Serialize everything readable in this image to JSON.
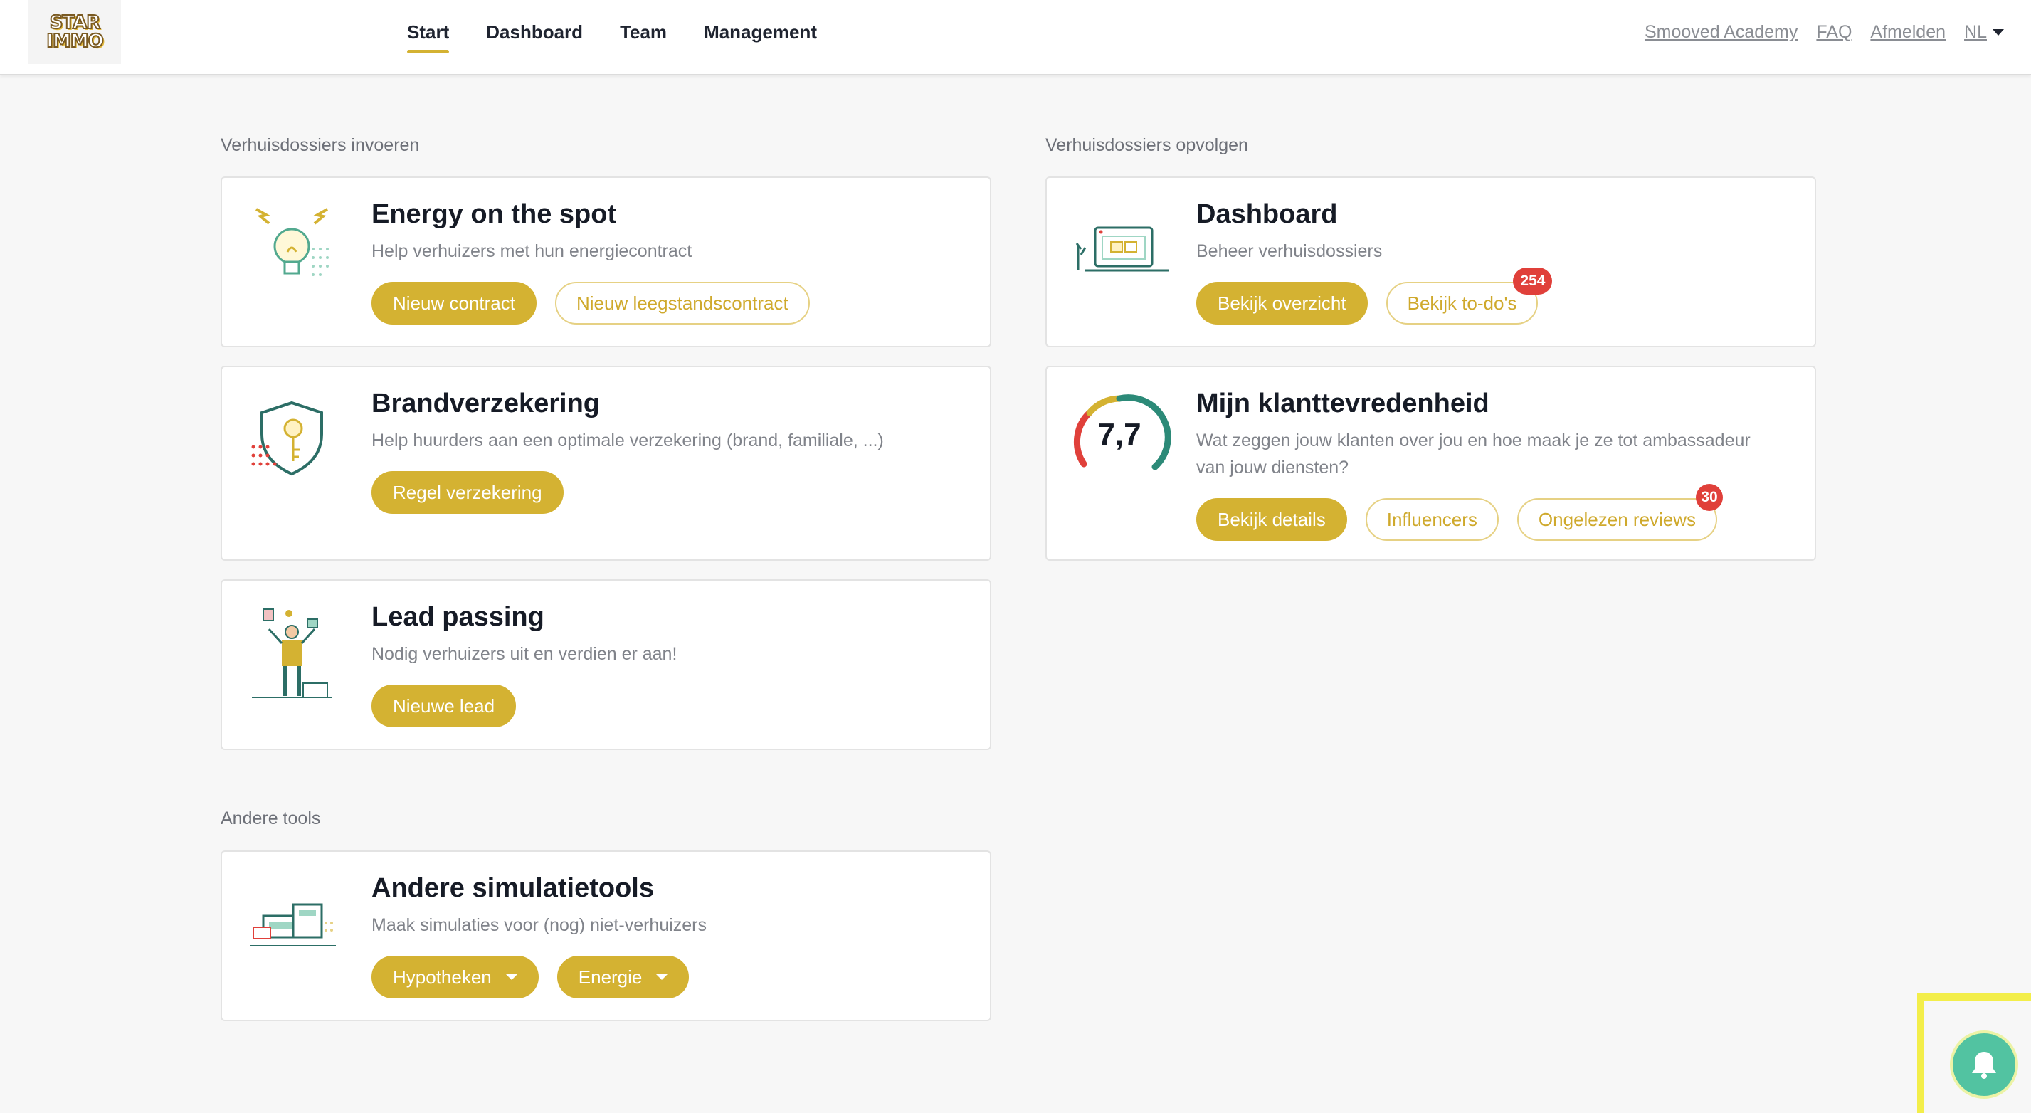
{
  "header": {
    "logo_line1": "STAR",
    "logo_line2": "IMMO",
    "nav": [
      "Start",
      "Dashboard",
      "Team",
      "Management"
    ],
    "links": {
      "academy": "Smooved Academy",
      "faq": "FAQ",
      "logout": "Afmelden",
      "lang": "NL"
    }
  },
  "sections": {
    "enter": "Verhuisdossiers invoeren",
    "follow": "Verhuisdossiers opvolgen",
    "other": "Andere tools"
  },
  "cards": {
    "energy": {
      "title": "Energy on the spot",
      "subtitle": "Help verhuizers met hun energiecontract",
      "btn1": "Nieuw contract",
      "btn2": "Nieuw leegstandscontract"
    },
    "fire": {
      "title": "Brandverzekering",
      "subtitle": "Help huurders aan een optimale verzekering (brand, familiale, ...)",
      "btn1": "Regel verzekering"
    },
    "lead": {
      "title": "Lead passing",
      "subtitle": "Nodig verhuizers uit en verdien er aan!",
      "btn1": "Nieuwe lead"
    },
    "sim": {
      "title": "Andere simulatietools",
      "subtitle": "Maak simulaties voor (nog) niet-verhuizers",
      "btn1": "Hypotheken",
      "btn2": "Energie"
    },
    "dashboard": {
      "title": "Dashboard",
      "subtitle": "Beheer verhuisdossiers",
      "btn1": "Bekijk overzicht",
      "btn2": "Bekijk to-do's",
      "badge": "254"
    },
    "satisfaction": {
      "title": "Mijn klanttevredenheid",
      "subtitle_line1": "Wat zeggen jouw klanten over jou en hoe maak je ze tot ambassadeur",
      "subtitle_line2": "van jouw diensten?",
      "score": "7,7",
      "score_fraction": 0.77,
      "btn1": "Bekijk details",
      "btn2": "Influencers",
      "btn3": "Ongelezen reviews",
      "badge": "30"
    }
  },
  "colors": {
    "accent": "#d4b232",
    "badge": "#e0403a",
    "bell": "#52c3a1"
  },
  "icons": [
    "lightbulb-icon",
    "shield-key-icon",
    "juggler-icon",
    "calculator-icon",
    "laptop-icon",
    "bell-icon",
    "caret-down-icon"
  ]
}
